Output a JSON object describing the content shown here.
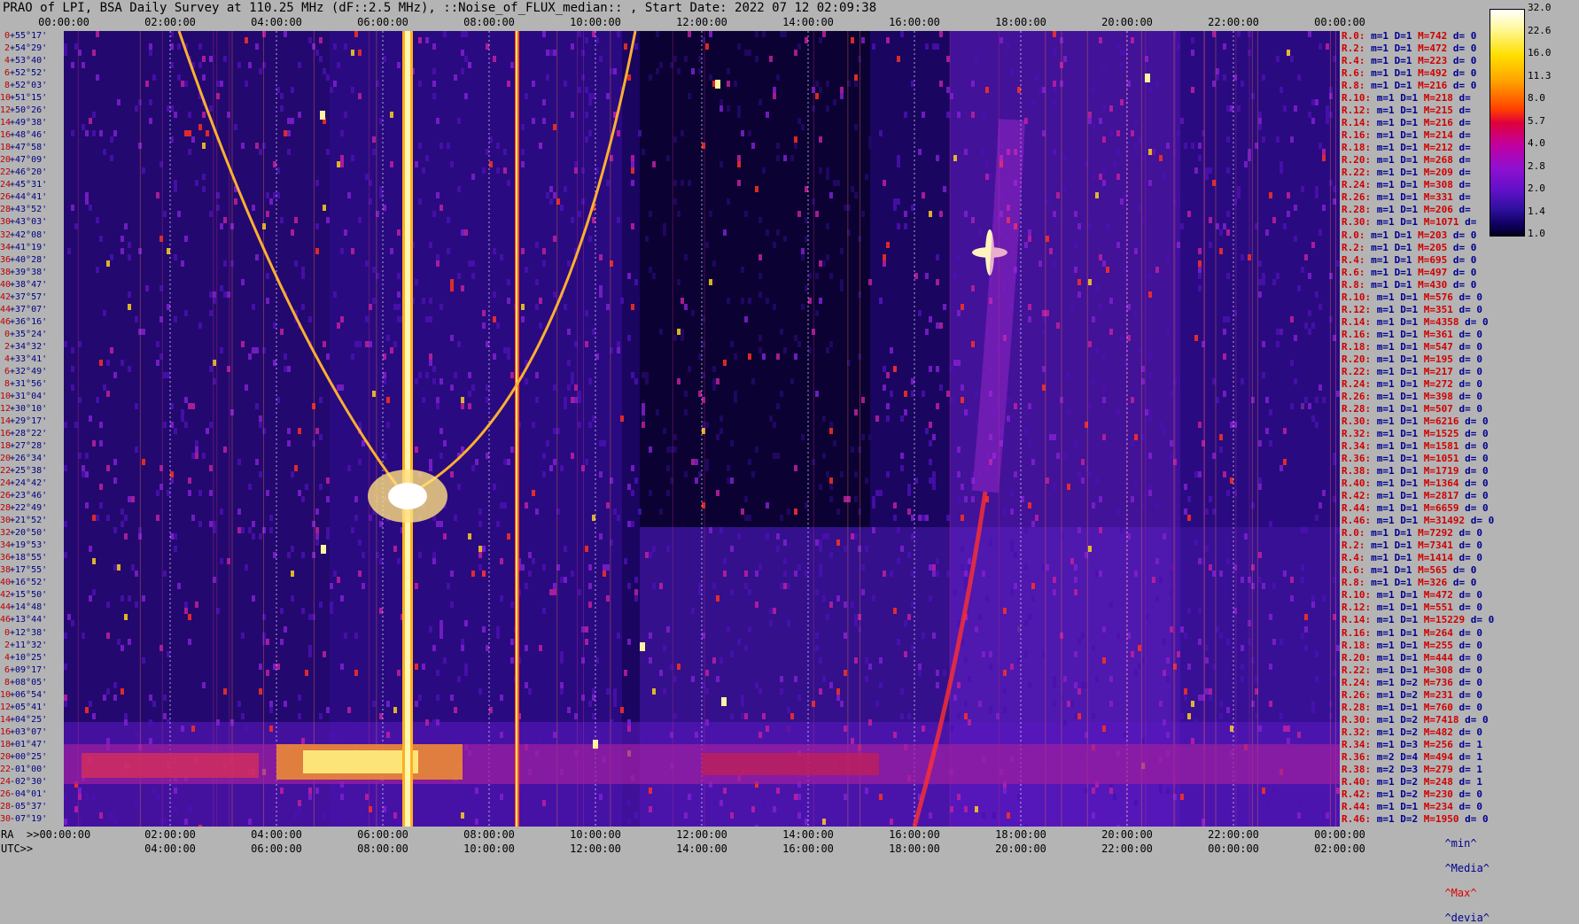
{
  "title": "PRAO of LPI, BSA Daily Survey at 110.25 MHz (dF::2.5 MHz), ::Noise_of_FLUX_median:: , Start Date: 2022 07 12 02:09:38",
  "chart_data": {
    "type": "heatmap",
    "top_axis_labels": [
      "00:00:00",
      "02:00:00",
      "04:00:00",
      "06:00:00",
      "08:00:00",
      "10:00:00",
      "12:00:00",
      "14:00:00",
      "16:00:00",
      "18:00:00",
      "20:00:00",
      "22:00:00",
      "00:00:00"
    ],
    "ra_axis_labels": [
      ">>00:00:00",
      "02:00:00",
      "04:00:00",
      "06:00:00",
      "08:00:00",
      "10:00:00",
      "12:00:00",
      "14:00:00",
      "16:00:00",
      "18:00:00",
      "20:00:00",
      "22:00:00",
      "00:00:00"
    ],
    "utc_axis_labels": [
      "04:00:00",
      "06:00:00",
      "08:00:00",
      "10:00:00",
      "12:00:00",
      "14:00:00",
      "16:00:00",
      "18:00:00",
      "20:00:00",
      "22:00:00",
      "00:00:00",
      "02:00:00"
    ],
    "ra_label": "RA",
    "utc_label": "UTC>>",
    "colorbar_ticks": [
      "32.0",
      "22.6",
      "16.0",
      "11.3",
      "8.0",
      "5.7",
      "4.0",
      "2.8",
      "2.0",
      "1.4",
      "1.0"
    ],
    "declinations": [
      "+55°17'",
      "+54°29'",
      "+53°40'",
      "+52°52'",
      "+52°03'",
      "+51°15'",
      "+50°26'",
      "+49°38'",
      "+48°46'",
      "+47°58'",
      "+47°09'",
      "+46°20'",
      "+45°31'",
      "+44°41'",
      "+43°52'",
      "+43°03'",
      "+42°08'",
      "+41°19'",
      "+40°28'",
      "+39°38'",
      "+38°47'",
      "+37°57'",
      "+37°07'",
      "+36°16'",
      "+35°24'",
      "+34°32'",
      "+33°41'",
      "+32°49'",
      "+31°56'",
      "+31°04'",
      "+30°10'",
      "+29°17'",
      "+28°22'",
      "+27°28'",
      "+26°34'",
      "+25°38'",
      "+24°42'",
      "+23°46'",
      "+22°49'",
      "+21°52'",
      "+20°50'",
      "+19°53'",
      "+18°55'",
      "+17°55'",
      "+16°52'",
      "+15°50'",
      "+14°48'",
      "+13°44'",
      "+12°38'",
      "+11°32'",
      "+10°25'",
      "+09°17'",
      "+08°05'",
      "+06°54'",
      "+05°41'",
      "+04°25'",
      "+03°07'",
      "+01°47'",
      "+00°25'",
      "-01°00'",
      "-02°30'",
      "-04°01'",
      "-05°37'",
      "-07°19'"
    ],
    "dec_indices": [
      "0",
      "2",
      "4",
      "6",
      "8",
      "10",
      "12",
      "14",
      "16",
      "18",
      "20",
      "22",
      "24",
      "26",
      "28",
      "30",
      "32",
      "34",
      "36",
      "38",
      "40",
      "42",
      "44",
      "46",
      "0",
      "2",
      "4",
      "6",
      "8",
      "10",
      "12",
      "14",
      "16",
      "18",
      "20",
      "22",
      "24",
      "26",
      "28",
      "30",
      "32",
      "34",
      "36",
      "38",
      "40",
      "42",
      "44",
      "46",
      "0",
      "2",
      "4",
      "6",
      "8",
      "10",
      "12",
      "14",
      "16",
      "18",
      "20",
      "22",
      "24",
      "26",
      "28",
      "30"
    ],
    "stats": [
      {
        "r": "R.0:",
        "m": "m=1",
        "D": "D=1",
        "M": "M=742",
        "d": "d= 0"
      },
      {
        "r": "R.2:",
        "m": "m=1",
        "D": "D=1",
        "M": "M=472",
        "d": "d= 0"
      },
      {
        "r": "R.4:",
        "m": "m=1",
        "D": "D=1",
        "M": "M=223",
        "d": "d= 0"
      },
      {
        "r": "R.6:",
        "m": "m=1",
        "D": "D=1",
        "M": "M=492",
        "d": "d= 0"
      },
      {
        "r": "R.8:",
        "m": "m=1",
        "D": "D=1",
        "M": "M=216",
        "d": "d= 0"
      },
      {
        "r": "R.10:",
        "m": "m=1",
        "D": "D=1",
        "M": "M=218",
        "d": "d="
      },
      {
        "r": "R.12:",
        "m": "m=1",
        "D": "D=1",
        "M": "M=215",
        "d": "d="
      },
      {
        "r": "R.14:",
        "m": "m=1",
        "D": "D=1",
        "M": "M=216",
        "d": "d="
      },
      {
        "r": "R.16:",
        "m": "m=1",
        "D": "D=1",
        "M": "M=214",
        "d": "d="
      },
      {
        "r": "R.18:",
        "m": "m=1",
        "D": "D=1",
        "M": "M=212",
        "d": "d="
      },
      {
        "r": "R.20:",
        "m": "m=1",
        "D": "D=1",
        "M": "M=268",
        "d": "d="
      },
      {
        "r": "R.22:",
        "m": "m=1",
        "D": "D=1",
        "M": "M=209",
        "d": "d="
      },
      {
        "r": "R.24:",
        "m": "m=1",
        "D": "D=1",
        "M": "M=308",
        "d": "d="
      },
      {
        "r": "R.26:",
        "m": "m=1",
        "D": "D=1",
        "M": "M=331",
        "d": "d="
      },
      {
        "r": "R.28:",
        "m": "m=1",
        "D": "D=1",
        "M": "M=206",
        "d": "d="
      },
      {
        "r": "R.30:",
        "m": "m=1",
        "D": "D=1",
        "M": "M=1071",
        "d": "d="
      },
      {
        "r": "R.0:",
        "m": "m=1",
        "D": "D=1",
        "M": "M=203",
        "d": "d= 0"
      },
      {
        "r": "R.2:",
        "m": "m=1",
        "D": "D=1",
        "M": "M=205",
        "d": "d= 0"
      },
      {
        "r": "R.4:",
        "m": "m=1",
        "D": "D=1",
        "M": "M=695",
        "d": "d= 0"
      },
      {
        "r": "R.6:",
        "m": "m=1",
        "D": "D=1",
        "M": "M=497",
        "d": "d= 0"
      },
      {
        "r": "R.8:",
        "m": "m=1",
        "D": "D=1",
        "M": "M=430",
        "d": "d= 0"
      },
      {
        "r": "R.10:",
        "m": "m=1",
        "D": "D=1",
        "M": "M=576",
        "d": "d= 0"
      },
      {
        "r": "R.12:",
        "m": "m=1",
        "D": "D=1",
        "M": "M=351",
        "d": "d= 0"
      },
      {
        "r": "R.14:",
        "m": "m=1",
        "D": "D=1",
        "M": "M=4358",
        "d": "d= 0"
      },
      {
        "r": "R.16:",
        "m": "m=1",
        "D": "D=1",
        "M": "M=361",
        "d": "d= 0"
      },
      {
        "r": "R.18:",
        "m": "m=1",
        "D": "D=1",
        "M": "M=547",
        "d": "d= 0"
      },
      {
        "r": "R.20:",
        "m": "m=1",
        "D": "D=1",
        "M": "M=195",
        "d": "d= 0"
      },
      {
        "r": "R.22:",
        "m": "m=1",
        "D": "D=1",
        "M": "M=217",
        "d": "d= 0"
      },
      {
        "r": "R.24:",
        "m": "m=1",
        "D": "D=1",
        "M": "M=272",
        "d": "d= 0"
      },
      {
        "r": "R.26:",
        "m": "m=1",
        "D": "D=1",
        "M": "M=398",
        "d": "d= 0"
      },
      {
        "r": "R.28:",
        "m": "m=1",
        "D": "D=1",
        "M": "M=507",
        "d": "d= 0"
      },
      {
        "r": "R.30:",
        "m": "m=1",
        "D": "D=1",
        "M": "M=6216",
        "d": "d= 0"
      },
      {
        "r": "R.32:",
        "m": "m=1",
        "D": "D=1",
        "M": "M=1525",
        "d": "d= 0"
      },
      {
        "r": "R.34:",
        "m": "m=1",
        "D": "D=1",
        "M": "M=1581",
        "d": "d= 0"
      },
      {
        "r": "R.36:",
        "m": "m=1",
        "D": "D=1",
        "M": "M=1051",
        "d": "d= 0"
      },
      {
        "r": "R.38:",
        "m": "m=1",
        "D": "D=1",
        "M": "M=1719",
        "d": "d= 0"
      },
      {
        "r": "R.40:",
        "m": "m=1",
        "D": "D=1",
        "M": "M=1364",
        "d": "d= 0"
      },
      {
        "r": "R.42:",
        "m": "m=1",
        "D": "D=1",
        "M": "M=2817",
        "d": "d= 0"
      },
      {
        "r": "R.44:",
        "m": "m=1",
        "D": "D=1",
        "M": "M=6659",
        "d": "d= 0"
      },
      {
        "r": "R.46:",
        "m": "m=1",
        "D": "D=1",
        "M": "M=31492",
        "d": "d= 0"
      },
      {
        "r": "R.0:",
        "m": "m=1",
        "D": "D=1",
        "M": "M=7292",
        "d": "d= 0"
      },
      {
        "r": "R.2:",
        "m": "m=1",
        "D": "D=1",
        "M": "M=7341",
        "d": "d= 0"
      },
      {
        "r": "R.4:",
        "m": "m=1",
        "D": "D=1",
        "M": "M=1414",
        "d": "d= 0"
      },
      {
        "r": "R.6:",
        "m": "m=1",
        "D": "D=1",
        "M": "M=565",
        "d": "d= 0"
      },
      {
        "r": "R.8:",
        "m": "m=1",
        "D": "D=1",
        "M": "M=326",
        "d": "d= 0"
      },
      {
        "r": "R.10:",
        "m": "m=1",
        "D": "D=1",
        "M": "M=472",
        "d": "d= 0"
      },
      {
        "r": "R.12:",
        "m": "m=1",
        "D": "D=1",
        "M": "M=551",
        "d": "d= 0"
      },
      {
        "r": "R.14:",
        "m": "m=1",
        "D": "D=1",
        "M": "M=15229",
        "d": "d= 0"
      },
      {
        "r": "R.16:",
        "m": "m=1",
        "D": "D=1",
        "M": "M=264",
        "d": "d= 0"
      },
      {
        "r": "R.18:",
        "m": "m=1",
        "D": "D=1",
        "M": "M=255",
        "d": "d= 0"
      },
      {
        "r": "R.20:",
        "m": "m=1",
        "D": "D=1",
        "M": "M=444",
        "d": "d= 0"
      },
      {
        "r": "R.22:",
        "m": "m=1",
        "D": "D=1",
        "M": "M=308",
        "d": "d= 0"
      },
      {
        "r": "R.24:",
        "m": "m=1",
        "D": "D=2",
        "M": "M=736",
        "d": "d= 0"
      },
      {
        "r": "R.26:",
        "m": "m=1",
        "D": "D=2",
        "M": "M=231",
        "d": "d= 0"
      },
      {
        "r": "R.28:",
        "m": "m=1",
        "D": "D=1",
        "M": "M=760",
        "d": "d= 0"
      },
      {
        "r": "R.30:",
        "m": "m=1",
        "D": "D=2",
        "M": "M=7418",
        "d": "d= 0"
      },
      {
        "r": "R.32:",
        "m": "m=1",
        "D": "D=2",
        "M": "M=482",
        "d": "d= 0"
      },
      {
        "r": "R.34:",
        "m": "m=1",
        "D": "D=3",
        "M": "M=256",
        "d": "d= 1"
      },
      {
        "r": "R.36:",
        "m": "m=2",
        "D": "D=4",
        "M": "M=494",
        "d": "d= 1"
      },
      {
        "r": "R.38:",
        "m": "m=2",
        "D": "D=3",
        "M": "M=279",
        "d": "d= 1"
      },
      {
        "r": "R.40:",
        "m": "m=1",
        "D": "D=2",
        "M": "M=248",
        "d": "d= 1"
      },
      {
        "r": "R.42:",
        "m": "m=1",
        "D": "D=2",
        "M": "M=230",
        "d": "d= 0"
      },
      {
        "r": "R.44:",
        "m": "m=1",
        "D": "D=1",
        "M": "M=234",
        "d": "d= 0"
      },
      {
        "r": "R.46:",
        "m": "m=1",
        "D": "D=2",
        "M": "M=1950",
        "d": "d= 0"
      }
    ],
    "legend": {
      "min": "^min^",
      "median": "^Media^",
      "max": "^Max^",
      "devia": "^devia^"
    }
  },
  "colors": {
    "background": "#b4b4b4",
    "dark": "#0a0035",
    "purple": "#7a1fd0",
    "magenta": "#c010a0",
    "red": "#ff2020",
    "orange": "#ffa000",
    "yellow": "#ffee30",
    "white": "#ffffff"
  }
}
